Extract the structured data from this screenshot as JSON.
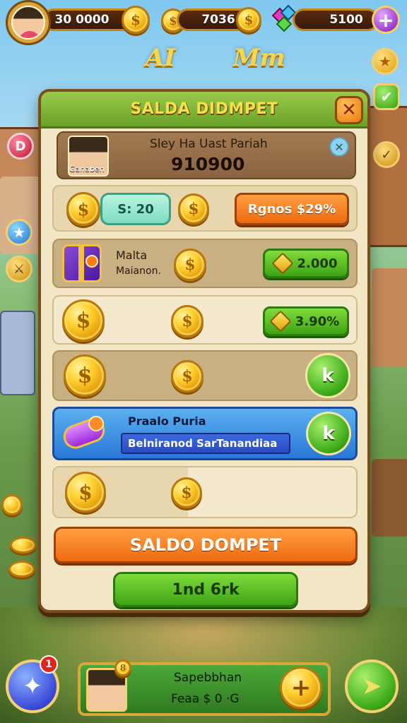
{
  "top_bar": {
    "coins_value": "30 0000",
    "gems_value": "7036",
    "energy_value": "5100"
  },
  "title_letters": {
    "left": "AI",
    "right": "Mm"
  },
  "panel": {
    "title": "SALDA DIDMPET",
    "profile": {
      "pic_label": "Ganaben",
      "name": "Sley Ha Uast Pariah",
      "balance": "910900"
    },
    "rows": [
      {
        "pill_label": "S: 20",
        "action_label": "Rgnos $29%"
      },
      {
        "item_title": "Malta",
        "item_subtitle": "Maianon.",
        "action_label": "2.000"
      },
      {
        "action_label": "3.90%"
      },
      {
        "action_label": "k"
      },
      {
        "title": "Praalo Puria",
        "subtitle": "Belniranod SarTanandiaa",
        "action_label": "k"
      },
      {}
    ],
    "primary_button": "SALDO DOMPET",
    "secondary_button": "1nd 6rk"
  },
  "bottom_bar": {
    "badge_count": "1",
    "card_title": "Sapebbhan",
    "card_subtitle": "Feaa $ 0 ·G",
    "level_badge": "8"
  },
  "colors": {
    "panel_bg": "#f3e6c4",
    "header_green": "#6aa02a",
    "title_yellow": "#f9e04a",
    "orange_button": "#ef6a10",
    "green_button": "#3ea316"
  }
}
